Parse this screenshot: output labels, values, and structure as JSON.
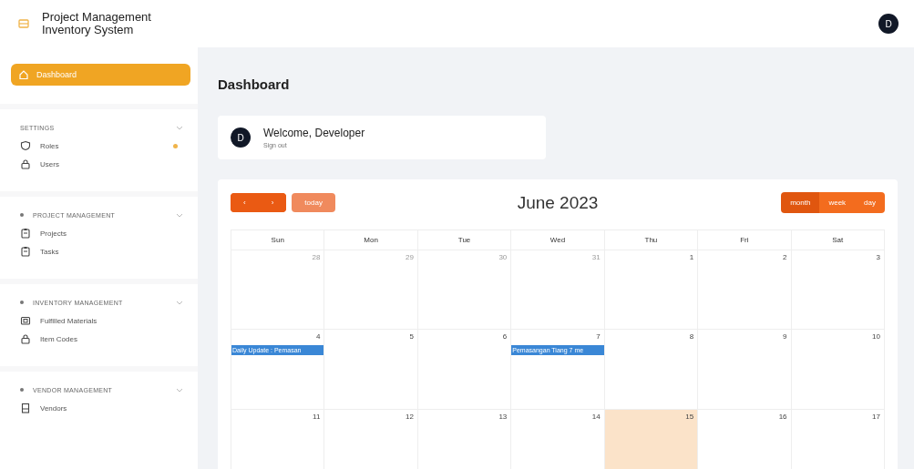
{
  "app": {
    "title": "Project Management Inventory System"
  },
  "user": {
    "initial": "D"
  },
  "sidebar": {
    "items": [
      {
        "label": "Dashboard",
        "selected": true
      }
    ],
    "groups": [
      {
        "title": "SETTINGS",
        "expanded": true,
        "items": [
          {
            "label": "Roles",
            "selected": false,
            "badge": true
          },
          {
            "label": "Users",
            "selected": false,
            "badge": false
          }
        ]
      },
      {
        "title": "PROJECT MANAGEMENT",
        "expanded": true,
        "items": [
          {
            "label": "Projects",
            "selected": false,
            "badge": false
          },
          {
            "label": "Tasks",
            "selected": false,
            "badge": false
          }
        ]
      },
      {
        "title": "INVENTORY MANAGEMENT",
        "expanded": true,
        "items": [
          {
            "label": "Fulfilled Materials",
            "selected": false,
            "badge": false
          },
          {
            "label": "Item Codes",
            "selected": false,
            "badge": false
          }
        ]
      },
      {
        "title": "VENDOR MANAGEMENT",
        "expanded": true,
        "items": [
          {
            "label": "Vendors",
            "selected": false,
            "badge": false
          }
        ]
      }
    ]
  },
  "page": {
    "title": "Dashboard"
  },
  "welcome": {
    "initial": "D",
    "title": "Welcome, Developer",
    "link": "Sign out"
  },
  "calendar": {
    "prev": "‹",
    "next": "›",
    "today": {
      "label": "today",
      "disabled": true
    },
    "title": "June 2023",
    "views": [
      {
        "label": "month",
        "selected": true
      },
      {
        "label": "week",
        "selected": false
      },
      {
        "label": "day",
        "selected": false
      }
    ],
    "weekdays": [
      "Sun",
      "Mon",
      "Tue",
      "Wed",
      "Thu",
      "Fri",
      "Sat"
    ],
    "weeks": [
      [
        {
          "day": "28",
          "other_month": true,
          "today": false
        },
        {
          "day": "29",
          "other_month": true,
          "today": false
        },
        {
          "day": "30",
          "other_month": true,
          "today": false
        },
        {
          "day": "31",
          "other_month": true,
          "today": false
        },
        {
          "day": "1",
          "other_month": false,
          "today": false
        },
        {
          "day": "2",
          "other_month": false,
          "today": false
        },
        {
          "day": "3",
          "other_month": false,
          "today": false
        }
      ],
      [
        {
          "day": "4",
          "other_month": false,
          "today": false,
          "events": [
            "Daily Update : Pemasan"
          ]
        },
        {
          "day": "5",
          "other_month": false,
          "today": false
        },
        {
          "day": "6",
          "other_month": false,
          "today": false
        },
        {
          "day": "7",
          "other_month": false,
          "today": false,
          "events": [
            "Pemasangan Tiang 7 me"
          ]
        },
        {
          "day": "8",
          "other_month": false,
          "today": false
        },
        {
          "day": "9",
          "other_month": false,
          "today": false
        },
        {
          "day": "10",
          "other_month": false,
          "today": false
        }
      ],
      [
        {
          "day": "11",
          "other_month": false,
          "today": false
        },
        {
          "day": "12",
          "other_month": false,
          "today": false
        },
        {
          "day": "13",
          "other_month": false,
          "today": false
        },
        {
          "day": "14",
          "other_month": false,
          "today": false
        },
        {
          "day": "15",
          "other_month": false,
          "today": true
        },
        {
          "day": "16",
          "other_month": false,
          "today": false
        },
        {
          "day": "17",
          "other_month": false,
          "today": false
        }
      ]
    ]
  }
}
